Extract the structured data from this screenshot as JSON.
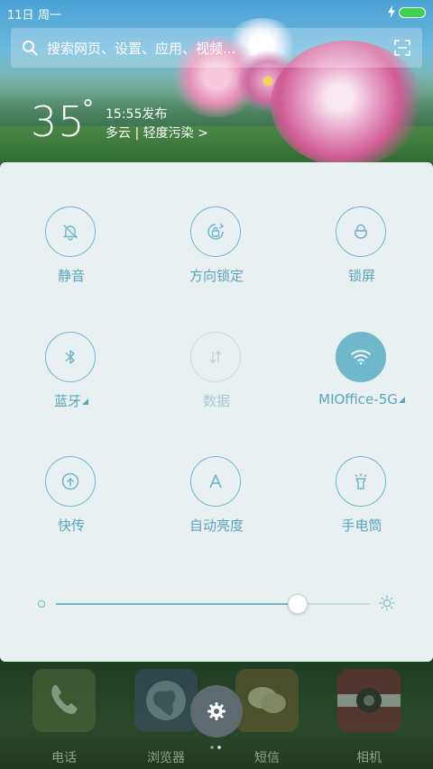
{
  "status_bar": {
    "time": "11日",
    "day": "周一"
  },
  "search": {
    "placeholder": "搜索网页、设置、应用、视频..."
  },
  "weather": {
    "temperature": "35",
    "degree": "°",
    "publish_time": "15:55发布",
    "condition": "多云 | 轻度污染 >"
  },
  "quick_settings": [
    {
      "label": "静音",
      "icon": "bell-off-icon",
      "state": "off"
    },
    {
      "label": "方向锁定",
      "icon": "rotation-lock-icon",
      "state": "off"
    },
    {
      "label": "锁屏",
      "icon": "lock-icon",
      "state": "off"
    },
    {
      "label": "蓝牙",
      "icon": "bluetooth-icon",
      "state": "off",
      "has_menu": true
    },
    {
      "label": "数据",
      "icon": "mobile-data-icon",
      "state": "disabled"
    },
    {
      "label": "MIOffice-5G",
      "icon": "wifi-icon",
      "state": "on",
      "has_menu": true
    },
    {
      "label": "快传",
      "icon": "share-icon",
      "state": "off"
    },
    {
      "label": "自动亮度",
      "icon": "auto-brightness-icon",
      "state": "off"
    },
    {
      "label": "手电筒",
      "icon": "flashlight-icon",
      "state": "off"
    }
  ],
  "brightness": {
    "level": 0.77
  },
  "dock": {
    "apps": [
      {
        "label": "电话",
        "icon": "phone-icon"
      },
      {
        "label": "浏览器",
        "icon": "browser-icon"
      },
      {
        "label": "短信",
        "icon": "messages-icon"
      },
      {
        "label": "相机",
        "icon": "camera-icon"
      }
    ]
  },
  "colors": {
    "accent": "#6fb8cc",
    "panel_bg": "#e9f0f1",
    "battery": "#3ed14f"
  }
}
